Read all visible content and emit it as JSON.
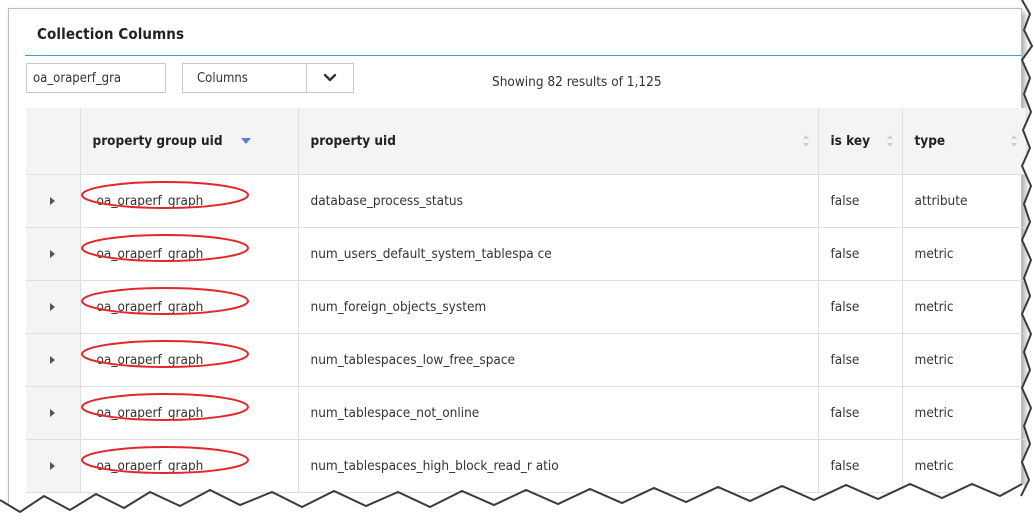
{
  "panel": {
    "title": "Collection Columns"
  },
  "filter": {
    "value": "oa_oraperf_gra"
  },
  "columns_select": {
    "label": "Columns"
  },
  "results": {
    "text": "Showing 82 results of 1,125"
  },
  "table": {
    "headers": [
      "property group uid",
      "property uid",
      "is key",
      "type"
    ],
    "rows": [
      {
        "group_uid": "oa_oraperf_graph",
        "property_uid": "database_process_status",
        "is_key": "false",
        "type": "attribute"
      },
      {
        "group_uid": "oa_oraperf_graph",
        "property_uid": "num_users_default_system_tablespa ce",
        "is_key": "false",
        "type": "metric"
      },
      {
        "group_uid": "oa_oraperf_graph",
        "property_uid": "num_foreign_objects_system",
        "is_key": "false",
        "type": "metric"
      },
      {
        "group_uid": "oa_oraperf_graph",
        "property_uid": "num_tablespaces_low_free_space",
        "is_key": "false",
        "type": "metric"
      },
      {
        "group_uid": "oa_oraperf_graph",
        "property_uid": "num_tablespace_not_online",
        "is_key": "false",
        "type": "metric"
      },
      {
        "group_uid": "oa_oraperf_graph",
        "property_uid": "num_tablespaces_high_block_read_r atio",
        "is_key": "false",
        "type": "metric"
      }
    ]
  },
  "icons": {
    "sort": "sort-descending-icon",
    "sortable": "sortable-icon",
    "expand": "expand-row-icon",
    "dropdown": "chevron-down-icon",
    "highlight": "red-highlight-oval"
  },
  "colors": {
    "accent_rule": "#39a3d9",
    "sort_active": "#5c7fd6",
    "highlight_oval": "#e3262b",
    "header_bg": "#f4f4f4"
  }
}
